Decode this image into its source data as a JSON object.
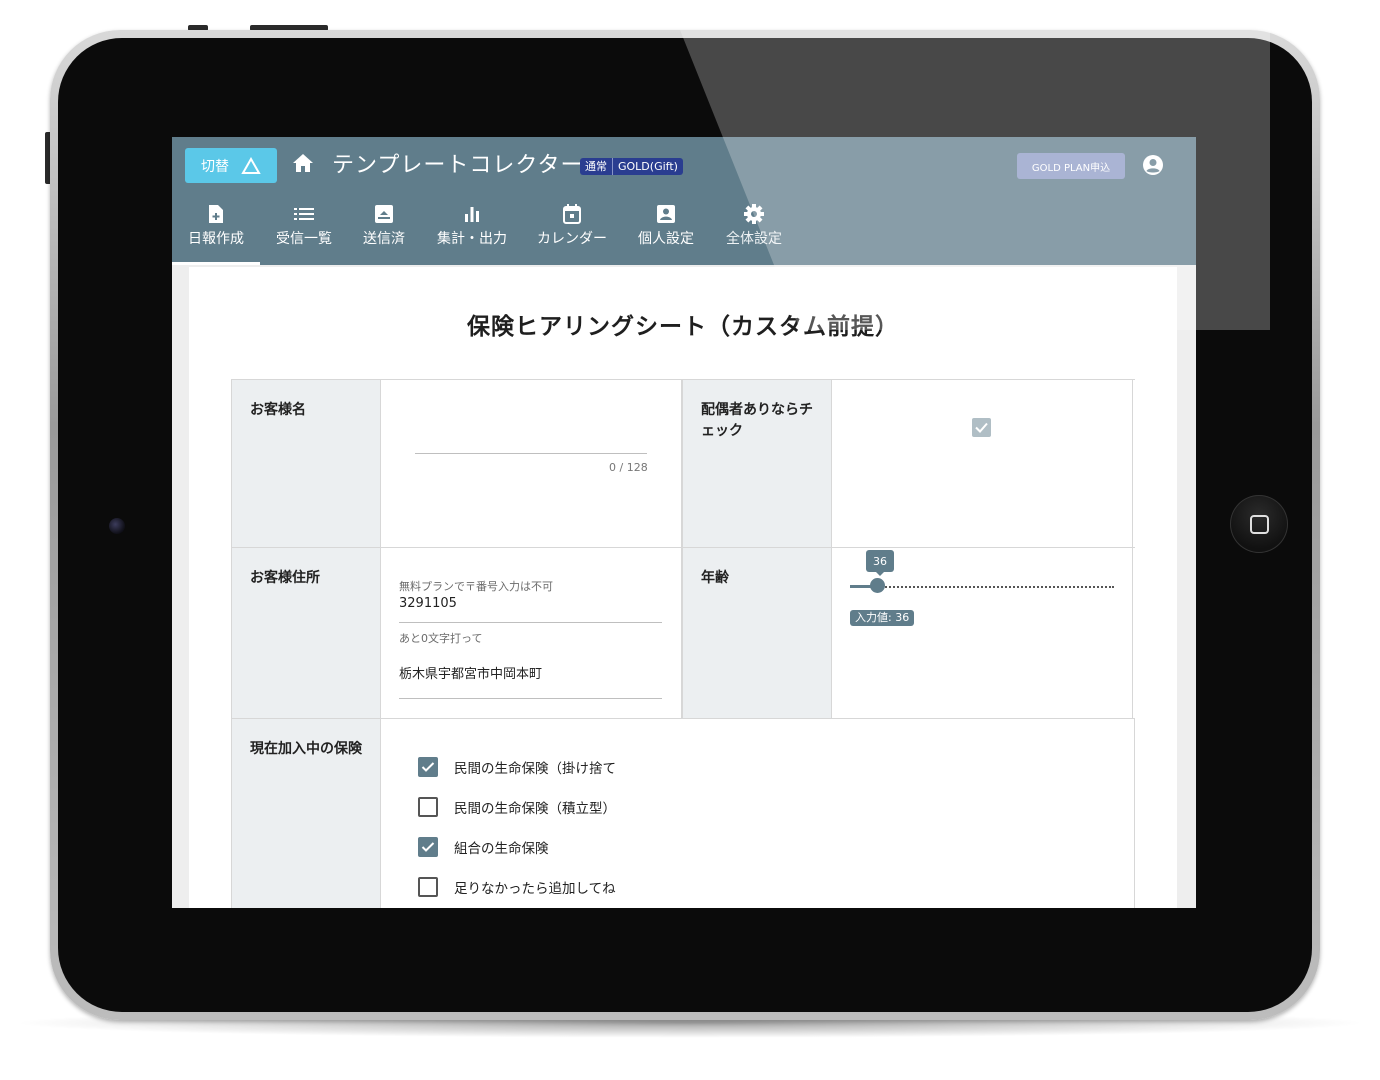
{
  "app": {
    "switch_label": "切替",
    "title": "テンプレートコレクター",
    "plan_tag_normal": "通常",
    "plan_tag_gold": "GOLD(Gift)",
    "gold_button": "GOLD PLAN申込"
  },
  "tabs": [
    {
      "label": "日報作成",
      "icon": "add-document-icon",
      "active": true
    },
    {
      "label": "受信一覧",
      "icon": "list-icon"
    },
    {
      "label": "送信済",
      "icon": "archive-icon"
    },
    {
      "label": "集計・出力",
      "icon": "bar-chart-icon"
    },
    {
      "label": "カレンダー",
      "icon": "calendar-icon"
    },
    {
      "label": "個人設定",
      "icon": "person-card-icon"
    },
    {
      "label": "全体設定",
      "icon": "gear-icon"
    }
  ],
  "form": {
    "title": "保険ヒアリングシート（カスタム前提）",
    "customer_name": {
      "label": "お客様名",
      "value": "",
      "counter": "0 / 128"
    },
    "spouse": {
      "label": "配偶者ありならチェック",
      "checked": true
    },
    "address": {
      "label": "お客様住所",
      "zip_label": "無料プランで〒番号入力は不可",
      "zip_value": "3291105",
      "addr_label": "あと0文字打って",
      "addr_value": "栃木県宇都宮市中岡本町"
    },
    "age": {
      "label": "年齢",
      "value": 36,
      "bubble": "36",
      "chip": "入力値: 36",
      "slider_fraction": 0.1
    },
    "insurance": {
      "label": "現在加入中の保険",
      "options": [
        {
          "label": "民間の生命保険（掛け捨て",
          "checked": true
        },
        {
          "label": "民間の生命保険（積立型）",
          "checked": false
        },
        {
          "label": "組合の生命保険",
          "checked": true
        },
        {
          "label": "足りなかったら追加してね",
          "checked": false
        }
      ]
    }
  },
  "colors": {
    "appbar": "#607d8b",
    "switch": "#5bc8e8",
    "gold_button": "#8e9bc6",
    "plan_badge": "#2a3d90"
  }
}
